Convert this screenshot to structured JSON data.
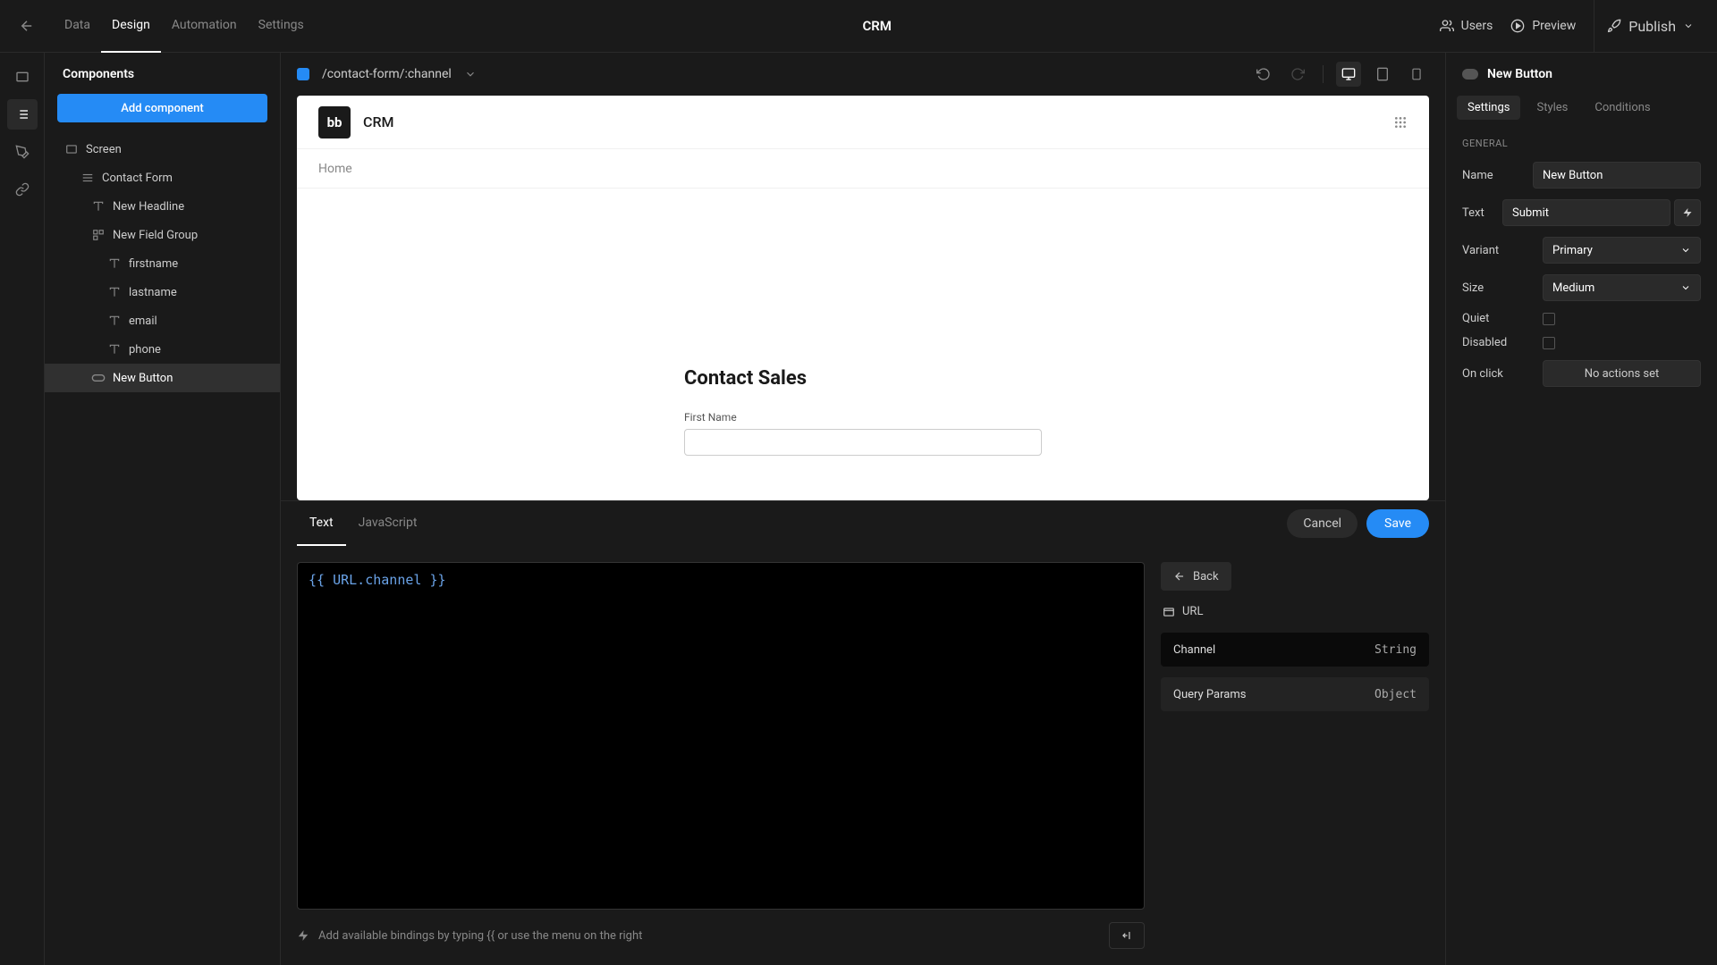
{
  "topbar": {
    "tabs": [
      "Data",
      "Design",
      "Automation",
      "Settings"
    ],
    "active_tab": 1,
    "title": "CRM",
    "actions": {
      "users": "Users",
      "preview": "Preview",
      "publish": "Publish"
    }
  },
  "sidebar": {
    "header": "Components",
    "add_label": "Add component",
    "tree": {
      "screen": "Screen",
      "contact_form": "Contact Form",
      "headline": "New Headline",
      "field_group": "New Field Group",
      "fields": [
        "firstname",
        "lastname",
        "email",
        "phone"
      ],
      "button": "New Button"
    }
  },
  "canvas_toolbar": {
    "route": "/contact-form/:channel"
  },
  "preview": {
    "app_name": "CRM",
    "nav_home": "Home",
    "form_title": "Contact Sales",
    "first_name_label": "First Name"
  },
  "editor": {
    "tabs": [
      "Text",
      "JavaScript"
    ],
    "active_tab": 0,
    "code": "{{ URL.channel }}",
    "cancel": "Cancel",
    "save": "Save",
    "hint": "Add available bindings by typing {{ or use the menu on the right",
    "back": "Back",
    "url_label": "URL",
    "bindings": [
      {
        "name": "Channel",
        "type": "String"
      },
      {
        "name": "Query Params",
        "type": "Object"
      }
    ]
  },
  "props": {
    "title": "New Button",
    "tabs": [
      "Settings",
      "Styles",
      "Conditions"
    ],
    "active_tab": 0,
    "section": "GENERAL",
    "name": {
      "label": "Name",
      "value": "New Button"
    },
    "text": {
      "label": "Text",
      "value": "Submit"
    },
    "variant": {
      "label": "Variant",
      "value": "Primary"
    },
    "size": {
      "label": "Size",
      "value": "Medium"
    },
    "quiet": {
      "label": "Quiet"
    },
    "disabled": {
      "label": "Disabled"
    },
    "onclick": {
      "label": "On click",
      "value": "No actions set"
    }
  }
}
